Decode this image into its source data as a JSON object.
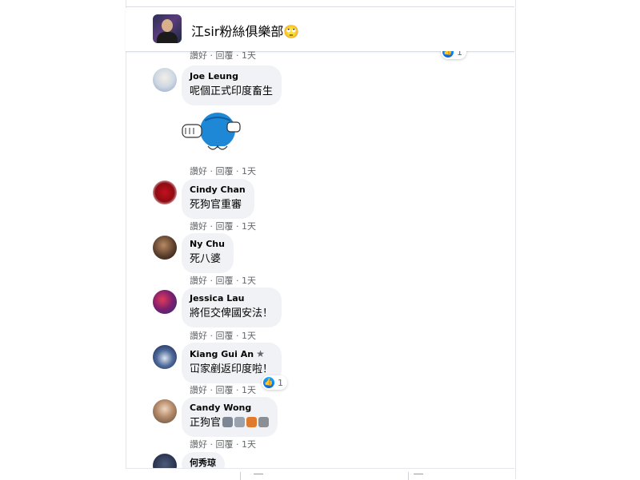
{
  "group": {
    "title": "江sir粉絲俱樂部🙄"
  },
  "actions": {
    "like": "讚好",
    "dot1": "·",
    "reply": "回覆",
    "dot2": "·"
  },
  "top_partial": {
    "time": "1天",
    "reaction_count": "1"
  },
  "comments": [
    {
      "author": "Joe Leung",
      "text": "呢個正式印度畜生",
      "time": "1天",
      "has_sticker": true
    },
    {
      "author": "Cindy Chan",
      "text": "死狗官重審",
      "time": "1天"
    },
    {
      "author": "Ny Chu",
      "text": "死八婆",
      "time": "1天"
    },
    {
      "author": "Jessica Lau",
      "text": "將佢交俾國安法！",
      "time": "1天"
    },
    {
      "author": "Kiang Gui An",
      "text": "冚家剷返印度啦！",
      "time": "1天",
      "reaction_count": "1"
    },
    {
      "author": "Candy Wong",
      "text": "正狗官",
      "time": "1天"
    },
    {
      "author": "何秀琼",
      "text": ""
    }
  ],
  "colors": {
    "bubble": "#f0f2f5",
    "meta": "#65676b",
    "like_blue": "#0165e1"
  }
}
